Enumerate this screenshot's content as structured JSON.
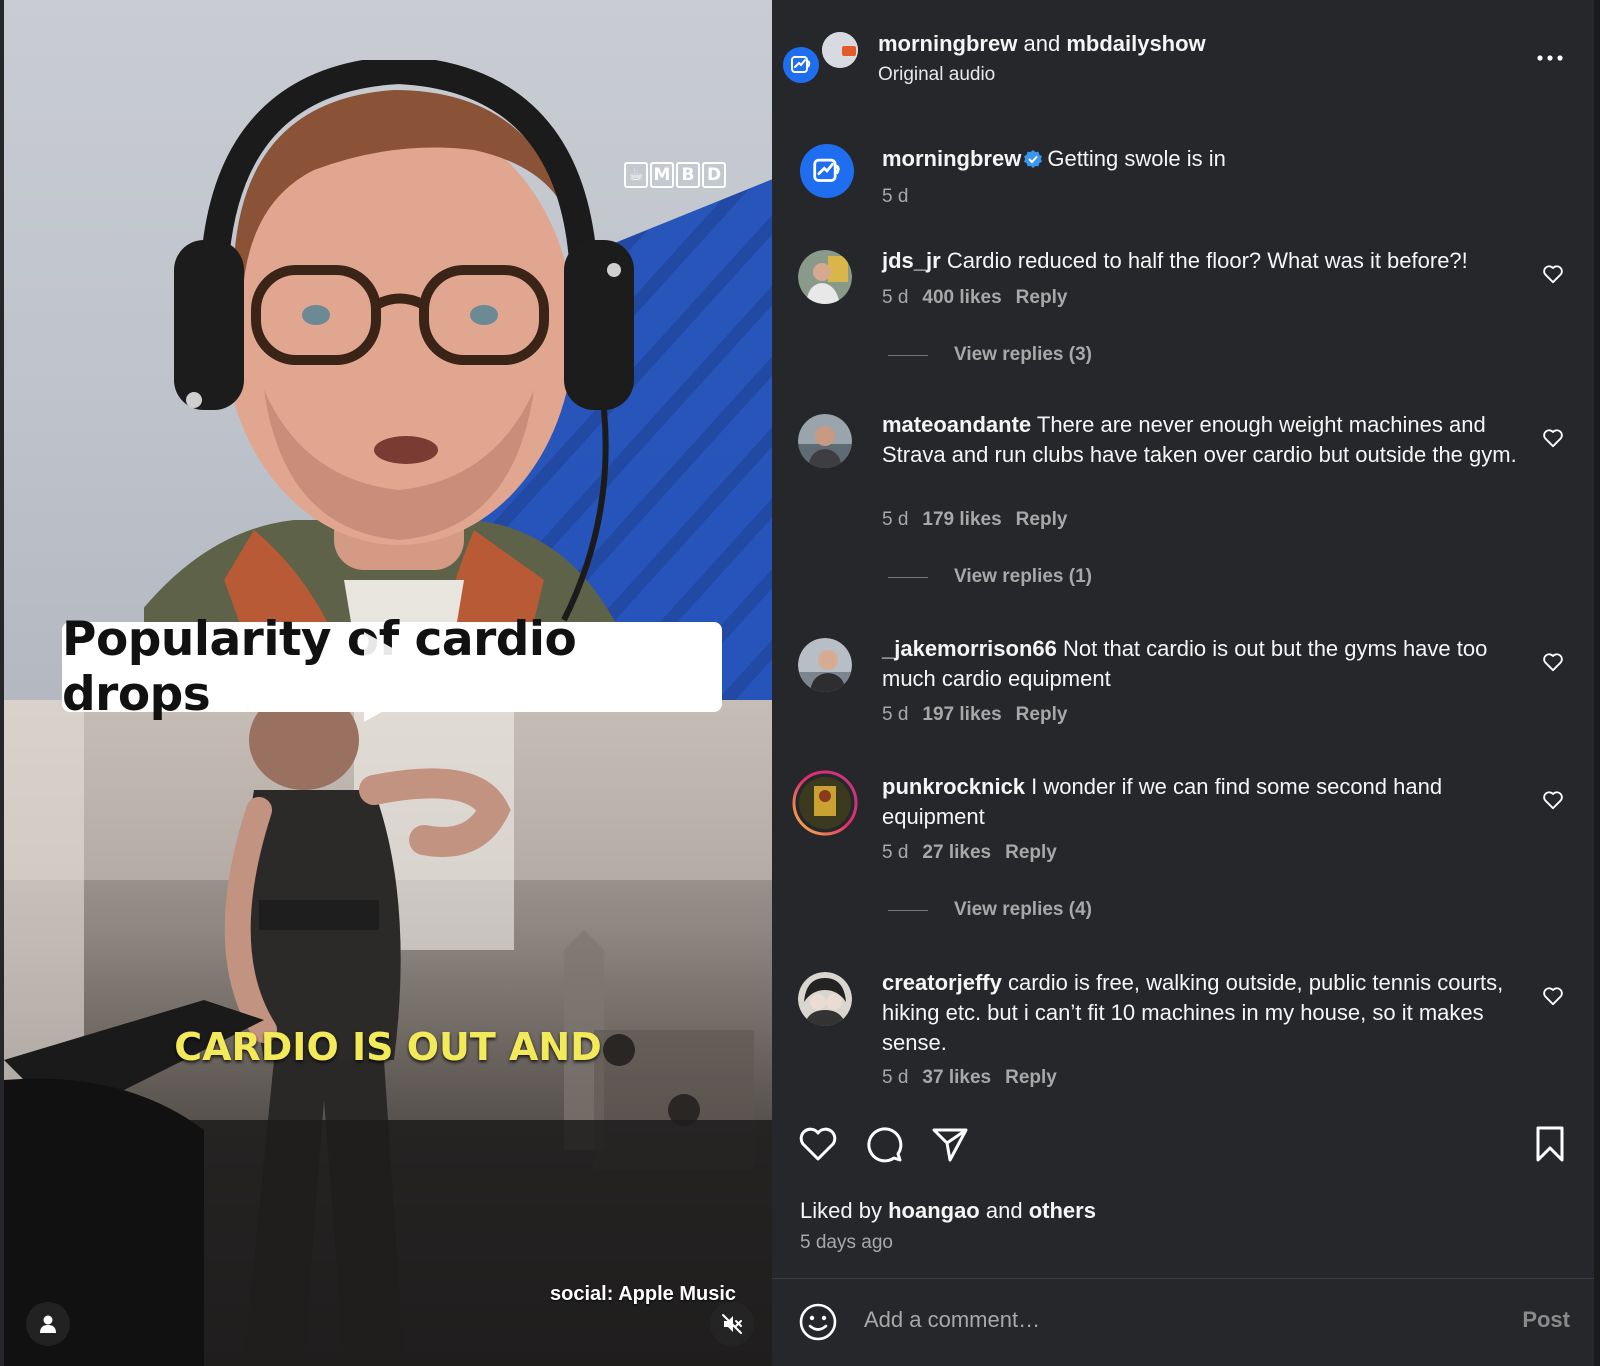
{
  "video": {
    "brand_letters": [
      "M",
      "B",
      "D"
    ],
    "title_card": "Popularity of cardio drops",
    "caption": "CARDIO IS OUT AND",
    "music_credit": "social: Apple Music"
  },
  "header": {
    "user1": "morningbrew",
    "joiner": "and",
    "user2": "mbdailyshow",
    "audio": "Original audio"
  },
  "post": {
    "username": "morningbrew",
    "text": "Getting swole is in",
    "time": "5 d"
  },
  "comments": [
    {
      "username": "jds_jr",
      "text": "Cardio reduced to half the floor? What was it before?!",
      "time": "5 d",
      "likes": "400 likes",
      "reply": "Reply",
      "view_replies": "View replies (3)"
    },
    {
      "username": "mateoandante",
      "text": "There are never enough weight machines and Strava and run clubs have taken over cardio but outside the gym.",
      "time": "5 d",
      "likes": "179 likes",
      "reply": "Reply",
      "view_replies": "View replies (1)"
    },
    {
      "username": "_jakemorrison66",
      "text": "Not that cardio is out but the gyms have too much cardio equipment",
      "time": "5 d",
      "likes": "197 likes",
      "reply": "Reply"
    },
    {
      "username": "punkrocknick",
      "text": "I wonder if we can find some second hand equipment",
      "time": "5 d",
      "likes": "27 likes",
      "reply": "Reply",
      "view_replies": "View replies (4)"
    },
    {
      "username": "creatorjeffy",
      "text": "cardio is free, walking outside, public tennis courts, hiking etc. but i can’t fit 10 machines in my house, so it makes sense.",
      "time": "5 d",
      "likes": "37 likes",
      "reply": "Reply"
    }
  ],
  "liked": {
    "prefix": "Liked by",
    "user": "hoangao",
    "joiner": "and",
    "others": "others",
    "ago": "5 days ago"
  },
  "composer": {
    "placeholder": "Add a comment…",
    "post_label": "Post"
  },
  "colors": {
    "background": "#26272b",
    "accent_blue": "#1f6ef0",
    "verified": "#3897f0",
    "caption_yellow": "#f3ea5a"
  },
  "icons": [
    "more-icon",
    "heart-icon",
    "comment-icon",
    "share-icon",
    "bookmark-icon",
    "emoji-icon",
    "play-icon",
    "mute-icon",
    "user-icon",
    "verified-icon"
  ]
}
